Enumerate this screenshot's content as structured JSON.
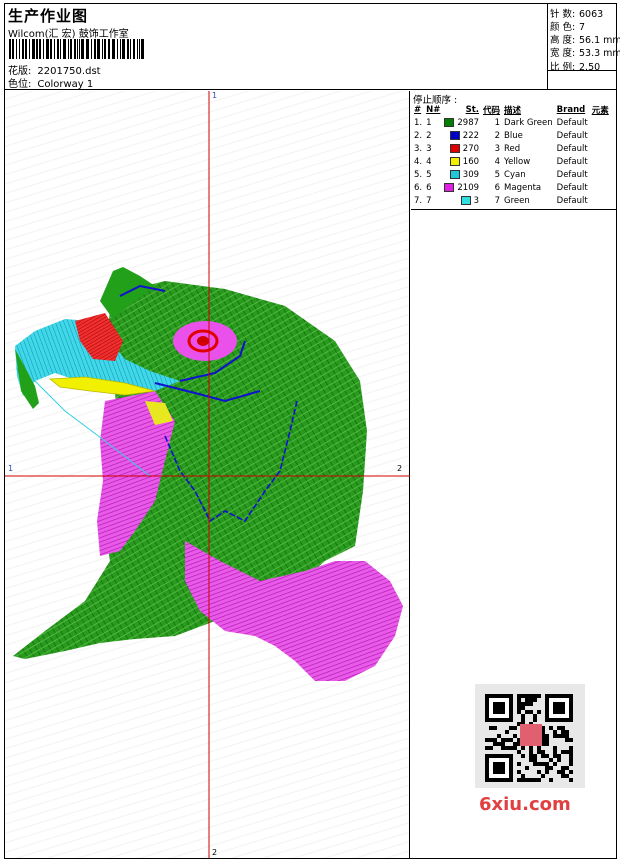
{
  "header": {
    "title": "生产作业图",
    "subtitle": "Wilcom(汇 宏) 鼓饰工作室",
    "design_label": "花版:",
    "design_value": "2201750.dst",
    "colorway_label": "色位:",
    "colorway_value": "Colorway 1"
  },
  "stats": {
    "stitches_label": "针 数:",
    "stitches": "6063",
    "colors_label": "颜 色:",
    "colors": "7",
    "height_label": "高 度:",
    "height": "56.1 mm",
    "width_label": "宽 度:",
    "width": "53.3 mm",
    "ratio_label": "比 例:",
    "ratio": "2.50"
  },
  "axes": {
    "top": "1",
    "bottom": "2",
    "left": "1",
    "right": "2"
  },
  "sequence": {
    "title": "停止顺序 :",
    "headers": [
      "#",
      "N#",
      "St.",
      "代码",
      "描述",
      "Brand",
      "元素"
    ],
    "rows": [
      {
        "idx": "1.",
        "n": "1",
        "color": "#008000",
        "st": "2987",
        "code": "1",
        "desc": "Dark Green",
        "brand": "Default"
      },
      {
        "idx": "2.",
        "n": "2",
        "color": "#0000cc",
        "st": "222",
        "code": "2",
        "desc": "Blue",
        "brand": "Default"
      },
      {
        "idx": "3.",
        "n": "3",
        "color": "#e00000",
        "st": "270",
        "code": "3",
        "desc": "Red",
        "brand": "Default"
      },
      {
        "idx": "4.",
        "n": "4",
        "color": "#f0f000",
        "st": "160",
        "code": "4",
        "desc": "Yellow",
        "brand": "Default"
      },
      {
        "idx": "5.",
        "n": "5",
        "color": "#20c8d8",
        "st": "309",
        "code": "5",
        "desc": "Cyan",
        "brand": "Default"
      },
      {
        "idx": "6.",
        "n": "6",
        "color": "#e020e0",
        "st": "2109",
        "code": "6",
        "desc": "Magenta",
        "brand": "Default"
      },
      {
        "idx": "7.",
        "n": "7",
        "color": "#30e0e0",
        "st": "3",
        "code": "7",
        "desc": "Green",
        "brand": "Default"
      }
    ]
  },
  "watermark": "6xiu.com",
  "colors": {
    "dark_green": "#008000",
    "blue": "#0000cc",
    "red": "#e00000",
    "yellow": "#f0f000",
    "cyan": "#20c8d8",
    "magenta": "#e020e0",
    "axis": "#d00000"
  }
}
